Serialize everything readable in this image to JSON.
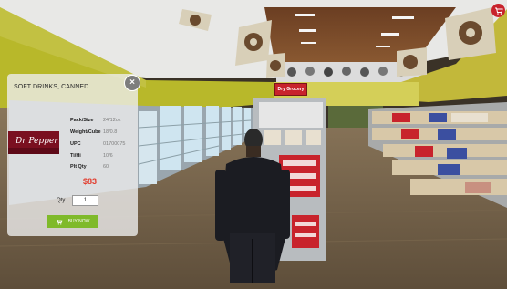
{
  "panel": {
    "title": "SOFT DRINKS, CANNED",
    "close_label": "×",
    "product_image": "dr-pepper-can-pack",
    "product_brand": "Dr Pepper",
    "specs": [
      {
        "label": "Pack/Size",
        "value": "24/12oz"
      },
      {
        "label": "Weight/Cube",
        "value": "18/0.8"
      },
      {
        "label": "UPC",
        "value": "01700075"
      },
      {
        "label": "Ti/Hi",
        "value": "10/6"
      },
      {
        "label": "Plt Qty",
        "value": "60"
      }
    ],
    "price": "$83",
    "qty_label": "Qty",
    "qty_value": "1",
    "buy_label": "BUY NOW",
    "buy_icon": "cart-icon",
    "accent": "#7fba2a",
    "price_color": "#e23b2c"
  },
  "scene": {
    "aisle_sign": "Dry Grocery",
    "top_right_icon": "cart-icon",
    "top_right_color": "#c8232c"
  }
}
